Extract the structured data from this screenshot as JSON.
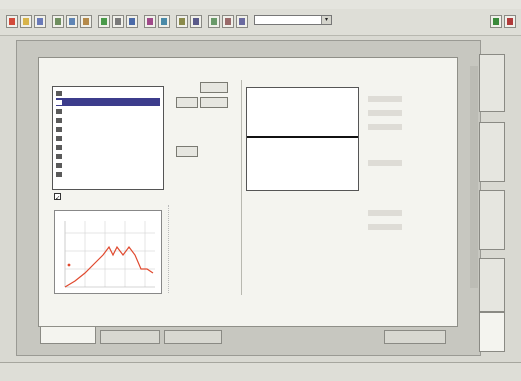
{
  "window": {
    "title": ""
  },
  "toolbar": {
    "buttons": [
      "new-icon",
      "open-icon",
      "save-icon",
      "cut-icon",
      "copy-icon",
      "paste-icon",
      "check-icon",
      "chart-icon",
      "undo-icon",
      "redo-icon",
      "zoom-icon",
      "grid-icon",
      "table-icon"
    ],
    "combo_value": "",
    "right_icons": [
      "chart-icon",
      "help-icon"
    ]
  },
  "left_group": {
    "label": "",
    "list_items": [
      {
        "label": "",
        "icon": "check-icon"
      },
      {
        "label": "",
        "icon": "check-icon",
        "selected": true
      },
      {
        "label": "",
        "icon": "check-icon"
      },
      {
        "label": "",
        "icon": "grid-icon"
      },
      {
        "label": "",
        "icon": "grid-icon"
      },
      {
        "label": "",
        "icon": "grid-icon"
      },
      {
        "label": "",
        "icon": "grid-icon"
      },
      {
        "label": "",
        "icon": "grid-icon"
      },
      {
        "label": "",
        "icon": "grid-icon"
      },
      {
        "label": "",
        "icon": "grid-icon"
      }
    ]
  },
  "mid_buttons": {
    "add_label": "",
    "remove_label": "",
    "move_label": ""
  },
  "right_group": {
    "label": ""
  },
  "checkbox": {
    "label": "",
    "checked": true
  },
  "vertical_tabs": [
    "",
    "",
    "",
    "",
    ""
  ],
  "bottom_tabs": [
    {
      "label": "",
      "active": true
    },
    {
      "label": "",
      "active": false
    },
    {
      "label": "",
      "active": false
    },
    {
      "label": "",
      "active": false
    }
  ],
  "status": {
    "left": "",
    "right": ""
  },
  "colors": {
    "chart_line": "#e0492e",
    "selection": "#3c3c8c",
    "panel": "#f4f4ef"
  }
}
